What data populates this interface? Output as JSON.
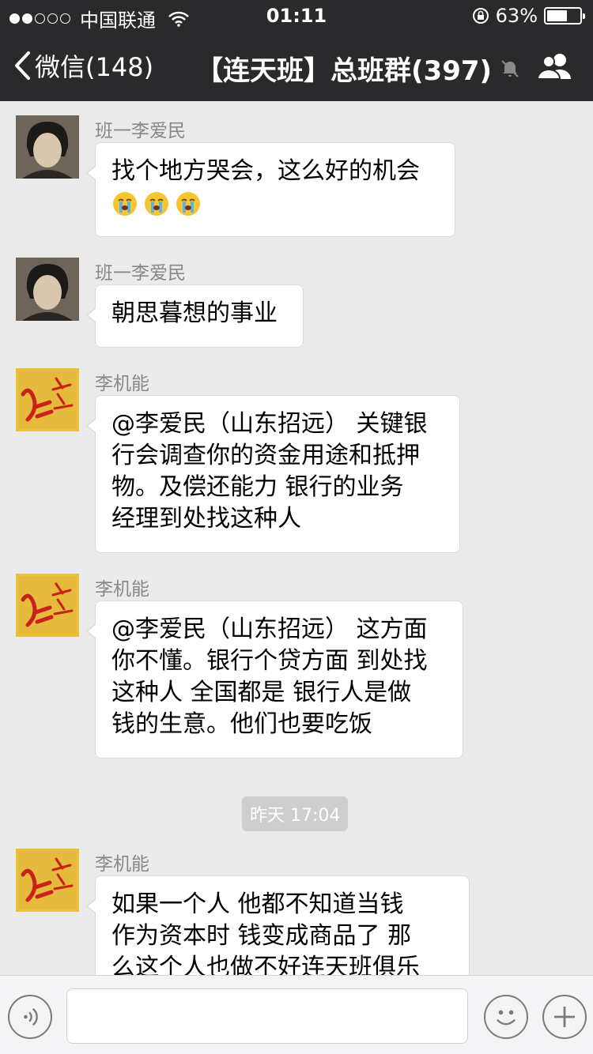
{
  "status_bar": {
    "signal_filled": 2,
    "signal_total": 5,
    "carrier": "中国联通",
    "time": "01:11",
    "battery_percent": "63%",
    "battery_level": 0.63
  },
  "nav": {
    "back_label": "微信(148)",
    "title": "【连天班】总班群(397)",
    "icons": [
      "chevron-left-icon",
      "mute-icon",
      "members-icon"
    ]
  },
  "messages": [
    {
      "sender": "班一李爱民",
      "avatar": "photo",
      "lines": [
        "找个地方哭会，这么好的机会"
      ],
      "emoji": [
        "crying-face-icon",
        "crying-face-icon",
        "crying-face-icon"
      ]
    },
    {
      "sender": "班一李爱民",
      "avatar": "photo",
      "lines": [
        "朝思暮想的事业"
      ]
    },
    {
      "sender": "李机能",
      "avatar": "logo",
      "lines": [
        "@李爱民（山东招远） 关键银",
        "行会调查你的资金用途和抵押",
        "物。及偿还能力  银行的业务",
        "经理到处找这种人"
      ]
    },
    {
      "sender": "李机能",
      "avatar": "logo",
      "lines": [
        "@李爱民（山东招远） 这方面",
        "你不懂。银行个贷方面 到处找",
        "这种人 全国都是 银行人是做",
        "钱的生意。他们也要吃饭"
      ]
    },
    {
      "sender": "李机能",
      "avatar": "logo",
      "lines": [
        "如果一个人  他都不知道当钱",
        "作为资本时 钱变成商品了 那",
        "么这个人也做不好连天班俱乐"
      ]
    }
  ],
  "timestamp": "昨天 17:04",
  "logo_text": "红 连天",
  "input_bar": {
    "icons": [
      "voice-icon",
      "emoji-icon",
      "plus-icon"
    ],
    "input_value": ""
  },
  "colors": {
    "bar_bg": "#2a2a2c",
    "chat_bg": "#ebebeb",
    "bubble_bg": "#ffffff",
    "logo_red": "#d5291e",
    "logo_gold": "#e9c33a"
  }
}
